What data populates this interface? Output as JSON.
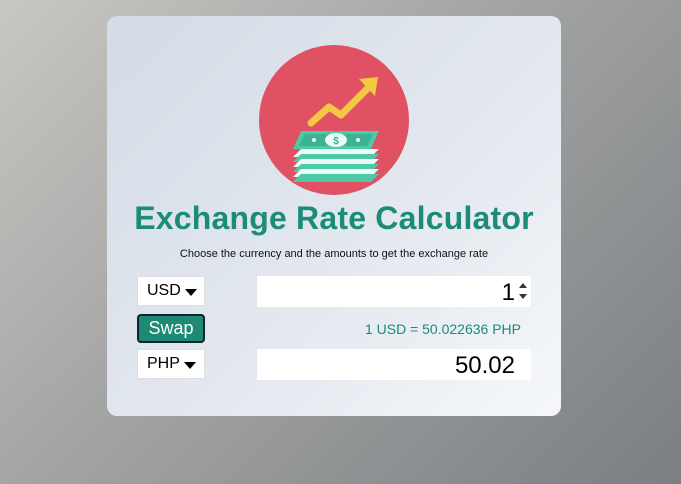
{
  "app": {
    "title": "Exchange Rate Calculator",
    "subtitle": "Choose the currency and the amounts to get the exchange rate"
  },
  "currency_one": {
    "selected": "USD",
    "amount": "1"
  },
  "swap": {
    "label": "Swap"
  },
  "rate": {
    "text": "1 USD = 50.022636 PHP"
  },
  "currency_two": {
    "selected": "PHP",
    "amount": "50.02"
  },
  "icons": {
    "logo": "money-stack-chart-icon",
    "dropdown": "caret-down-icon",
    "spinner": "number-spinner-icon"
  },
  "colors": {
    "accent": "#1a8c78",
    "logo_circle": "#e05263",
    "arrow": "#f5c842",
    "money": "#4dc9a7"
  }
}
